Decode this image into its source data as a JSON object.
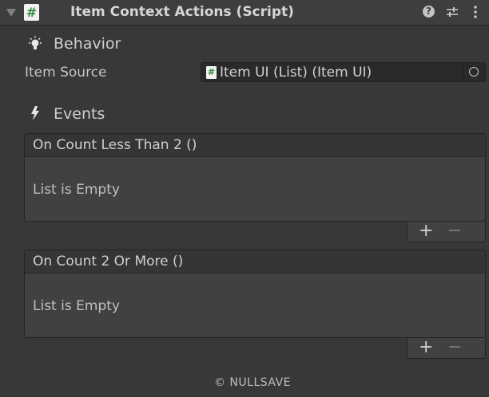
{
  "header": {
    "title": "Item Context Actions (Script)",
    "script_glyph": "#",
    "help_glyph": "?"
  },
  "behavior": {
    "section_label": "Behavior",
    "icon": "lightbulb-icon",
    "item_source_label": "Item Source",
    "item_source_value": "Item UI (List) (Item UI)",
    "object_glyph": "#"
  },
  "events": {
    "section_label": "Events",
    "icon": "lightning-icon",
    "lists": [
      {
        "title": "On Count Less Than 2 ()",
        "empty_text": "List is Empty",
        "add": "+",
        "remove": "−"
      },
      {
        "title": "On Count 2 Or More ()",
        "empty_text": "List is Empty",
        "add": "+",
        "remove": "−"
      }
    ]
  },
  "footer": {
    "text": "© NULLSAVE"
  },
  "colors": {
    "background": "#383838",
    "header": "#3e3e3e",
    "field": "#2a2a2a",
    "script_icon_green": "#2e8b3b"
  }
}
